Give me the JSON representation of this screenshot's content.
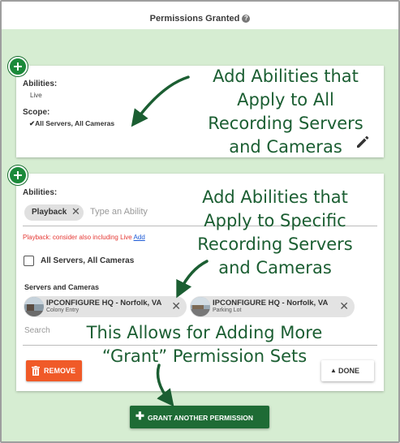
{
  "header": {
    "title": "Permissions Granted",
    "help_icon": "?"
  },
  "card1": {
    "abilities_label": "Abilities:",
    "abilities_value": "Live",
    "scope_label": "Scope:",
    "scope_value": "All Servers, All Cameras",
    "scope_check": "✔"
  },
  "card2": {
    "abilities_label": "Abilities:",
    "chip_label": "Playback",
    "ability_placeholder": "Type an Ability",
    "warning_text": "Playback: consider also including Live",
    "warning_link": "Add",
    "checkbox_label": "All Servers, All Cameras",
    "servers_label": "Servers and Cameras",
    "servers": [
      {
        "name": "IPCONFIGURE HQ - Norfolk, VA",
        "camera": "Colony Entry"
      },
      {
        "name": "IPCONFIGURE HQ - Norfolk, VA",
        "camera": "Parking Lot"
      }
    ],
    "search_placeholder": "Search",
    "remove_label": "REMOVE",
    "done_label": "DONE"
  },
  "grant_button": {
    "label": "GRANT ANOTHER PERMISSION"
  },
  "callouts": {
    "one": "Add Abilities that Apply to All Recording Servers and Cameras",
    "two": "Add Abilities that Apply to Specific Recording Servers and Cameras",
    "three": "This Allows for Adding More “Grant” Permission Sets"
  },
  "colors": {
    "accent_green": "#1e6b35",
    "background_green": "#d6edd2",
    "remove_orange": "#f05a28",
    "warning_red": "#e53935"
  }
}
